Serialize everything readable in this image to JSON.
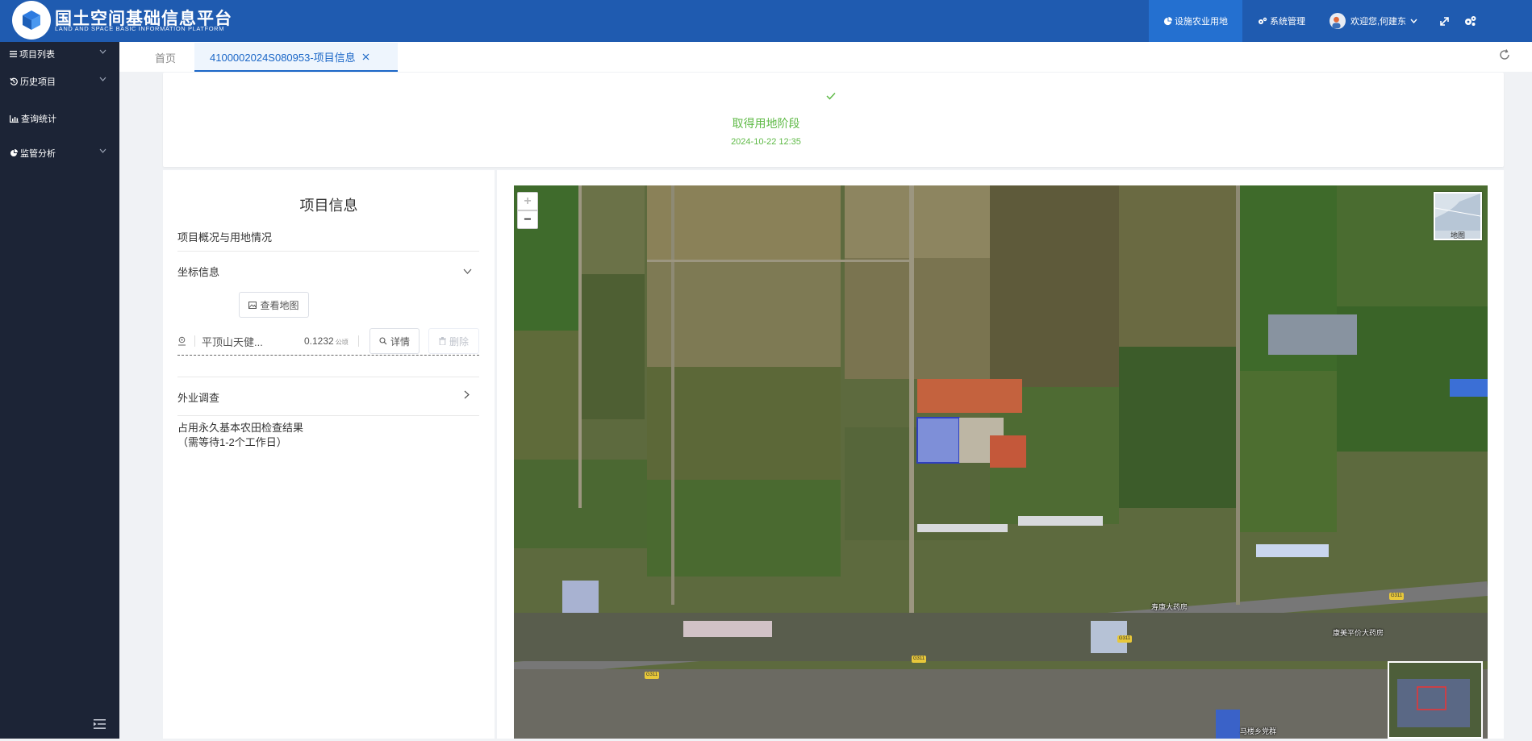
{
  "header": {
    "title": "国土空间基础信息平台",
    "subtitle": "LAND AND SPACE BASIC INFORMATION PLATFORM",
    "nav_active": "设施农业用地",
    "nav_system": "系统管理",
    "user_greeting": "欢迎您,何建东"
  },
  "sidebar": {
    "items": [
      {
        "label": "项目列表"
      },
      {
        "label": "历史项目"
      },
      {
        "label": "查询统计"
      },
      {
        "label": "监管分析"
      }
    ]
  },
  "tabs": {
    "home": "首页",
    "active": "4100002024S080953-项目信息"
  },
  "stage": {
    "name": "取得用地阶段",
    "date": "2024-10-22 12:35"
  },
  "info": {
    "title": "项目信息",
    "overview": "项目概况与用地情况",
    "coords_section": "坐标信息",
    "view_map_btn": "查看地图",
    "parcel_name": "平顶山天健...",
    "parcel_area": "0.1232",
    "parcel_unit": "公顷",
    "detail_btn": "详情",
    "delete_btn": "删除",
    "field_survey": "外业调查",
    "farmland_check_line1": "占用永久基本农田检查结果",
    "farmland_check_line2": "（需等待1-2个工作日）"
  },
  "map": {
    "zoom_in": "+",
    "zoom_out": "−",
    "layer_label": "地图",
    "labels": [
      "寿康大药房",
      "康美平价大药房",
      "马楼乡党群"
    ],
    "road_tag": "G311"
  },
  "colors": {
    "header_bg": "#1f5bb0",
    "sidebar_bg": "#1c2436",
    "accent": "#1a66c7",
    "success": "#5fba47"
  }
}
